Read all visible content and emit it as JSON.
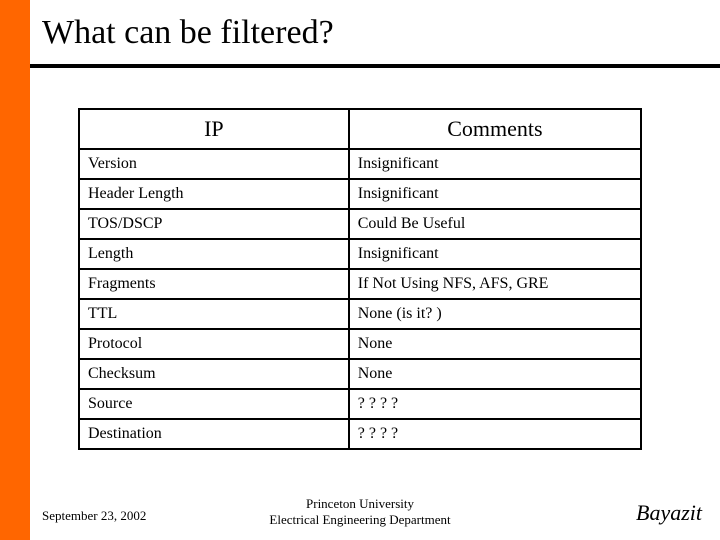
{
  "title": "What can be filtered?",
  "table": {
    "headers": {
      "col1": "IP",
      "col2": "Comments"
    },
    "rows": [
      {
        "ip": "Version",
        "comment": "Insignificant"
      },
      {
        "ip": "Header Length",
        "comment": "Insignificant"
      },
      {
        "ip": "TOS/DSCP",
        "comment": "Could Be Useful"
      },
      {
        "ip": "Length",
        "comment": "Insignificant"
      },
      {
        "ip": "Fragments",
        "comment": "If Not Using NFS, AFS, GRE"
      },
      {
        "ip": "TTL",
        "comment": "None (is it? )"
      },
      {
        "ip": "Protocol",
        "comment": "None"
      },
      {
        "ip": "Checksum",
        "comment": "None"
      },
      {
        "ip": "Source",
        "comment": "? ? ? ?"
      },
      {
        "ip": "Destination",
        "comment": "? ? ? ?"
      }
    ]
  },
  "footer": {
    "date": "September 23, 2002",
    "center_line1": "Princeton University",
    "center_line2": "Electrical Engineering Department",
    "author": "Bayazit"
  }
}
